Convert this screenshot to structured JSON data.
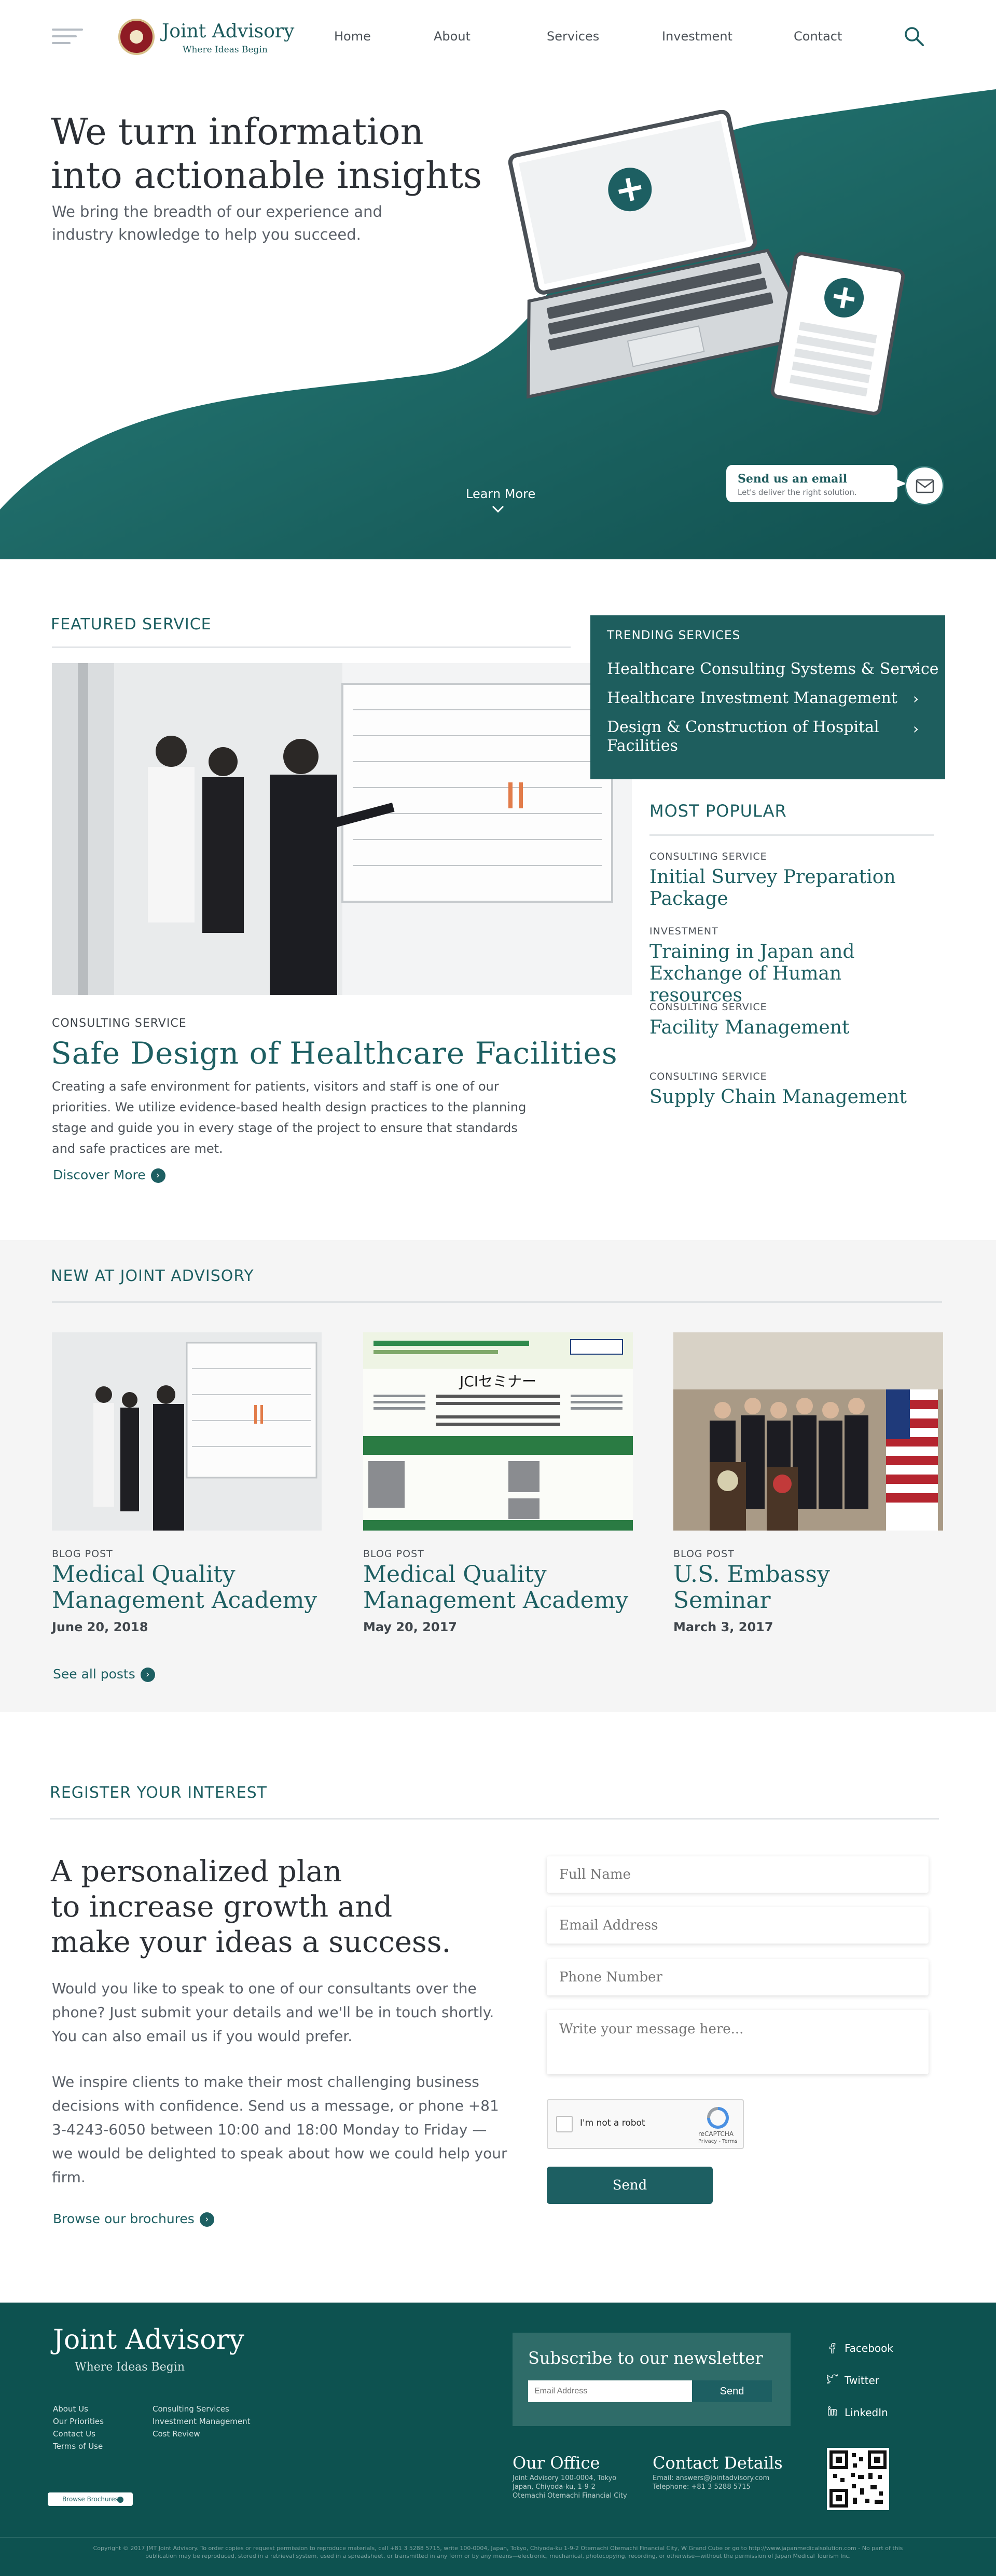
{
  "header": {
    "brand": "Joint Advisory",
    "tagline": "Where Ideas Begin",
    "nav": [
      "Home",
      "About",
      "Services",
      "Investment",
      "Contact"
    ]
  },
  "hero": {
    "headline_1": "We turn information",
    "headline_2": "into actionable insights",
    "subtext": "We bring the breadth of our experience and industry knowledge to help you succeed.",
    "learn_more": "Learn More",
    "email_title": "Send us an email",
    "email_sub": "Let's deliver the right solution.",
    "colors": {
      "teal": "#1e6e6b",
      "teal_dark": "#14504f"
    }
  },
  "featured": {
    "label": "FEATURED SERVICE",
    "category": "CONSULTING SERVICE",
    "title": "Safe Design of Healthcare Facilities",
    "body": "Creating a safe environment for patients, visitors and staff is one of our priorities. We utilize evidence-based health design practices to the planning stage and guide you in every stage of the project to ensure that standards and safe practices are met.",
    "cta": "Discover More"
  },
  "trending": {
    "label": "TRENDING SERVICES",
    "items": [
      "Healthcare Consulting Systems & Service",
      "Healthcare Investment Management",
      "Design & Construction of Hospital Facilities"
    ]
  },
  "popular": {
    "label": "MOST POPULAR",
    "items": [
      {
        "category": "CONSULTING SERVICE",
        "title": "Initial Survey Preparation Package"
      },
      {
        "category": "INVESTMENT",
        "title": "Training in Japan and Exchange of Human resources"
      },
      {
        "category": "CONSULTING SERVICE",
        "title": "Facility Management"
      },
      {
        "category": "CONSULTING SERVICE",
        "title": "Supply Chain Management"
      }
    ]
  },
  "news": {
    "label": "NEW AT JOINT ADVISORY",
    "cards": [
      {
        "category": "BLOG POST",
        "title": "Medical Quality Management Academy",
        "date": "June 20, 2018"
      },
      {
        "category": "BLOG POST",
        "title": "Medical Quality Management Academy",
        "date": "May 20, 2017",
        "poster_title": "JCIセミナー"
      },
      {
        "category": "BLOG POST",
        "title": "U.S. Embassy Seminar",
        "date": "March 3, 2017"
      }
    ],
    "see_all": "See all posts"
  },
  "register": {
    "label": "REGISTER YOUR INTEREST",
    "headline_1": "A personalized plan",
    "headline_2": "to increase growth and",
    "headline_3": "make your ideas a success.",
    "para_1": "Would you like to speak to one of our consultants over the phone? Just submit your details and we'll be in touch shortly. You can also email us if you would prefer.",
    "para_2": "We inspire clients to make their most challenging business decisions with confidence. Send us a message, or phone +81 3-4243-6050 between 10:00 and 18:00 Monday to Friday — we would be delighted to speak about how we could help your firm.",
    "browse": "Browse our brochures",
    "placeholders": {
      "name": "Full Name",
      "email": "Email Address",
      "phone": "Phone Number",
      "message": "Write your message here..."
    },
    "captcha_label": "I'm not a robot",
    "captcha_brand": "reCAPTCHA",
    "captcha_links": "Privacy - Terms",
    "send": "Send"
  },
  "footer": {
    "brand": "Joint Advisory",
    "tagline": "Where Ideas Begin",
    "links_col1": [
      "About Us",
      "Our Priorities",
      "Contact Us",
      "Terms of Use"
    ],
    "links_col2": [
      "Consulting Services",
      "Investment Management",
      "Cost Review"
    ],
    "newsletter_title": "Subscribe to our newsletter",
    "newsletter_placeholder": "Email Address",
    "newsletter_send": "Send",
    "social": [
      "Facebook",
      "Twitter",
      "LinkedIn"
    ],
    "office_title": "Our Office",
    "office_lines": [
      "Joint Advisory 100-0004, Tokyo",
      "Japan, Chiyoda-ku, 1-9-2",
      "Otemachi Otemachi Financial City"
    ],
    "contact_title": "Contact Details",
    "contact_lines": [
      "Email: answers@jointadvisory.com",
      "Telephone: +81 3 5288 5715"
    ],
    "brochure_btn": "Browse Brochures",
    "copyright": "Copyright © 2017 JMT Joint Advisory. To order copies or request permission to reproduce materials, call +81 3 5288 5715, write 100-0004, Japan, Tokyo, Chiyoda-ku 1-9-2 Otemachi Otemachi Financial City, W Grand Cube or go to http://www.japanmedicalsolution.com - No part of this publication may be reproduced, stored in a retrieval system, used in a spreadsheet, or transmitted in any form or by any means—electronic, mechanical, photocopying, recording, or otherwise—without the permission of Japan Medical Tourism Inc."
  }
}
